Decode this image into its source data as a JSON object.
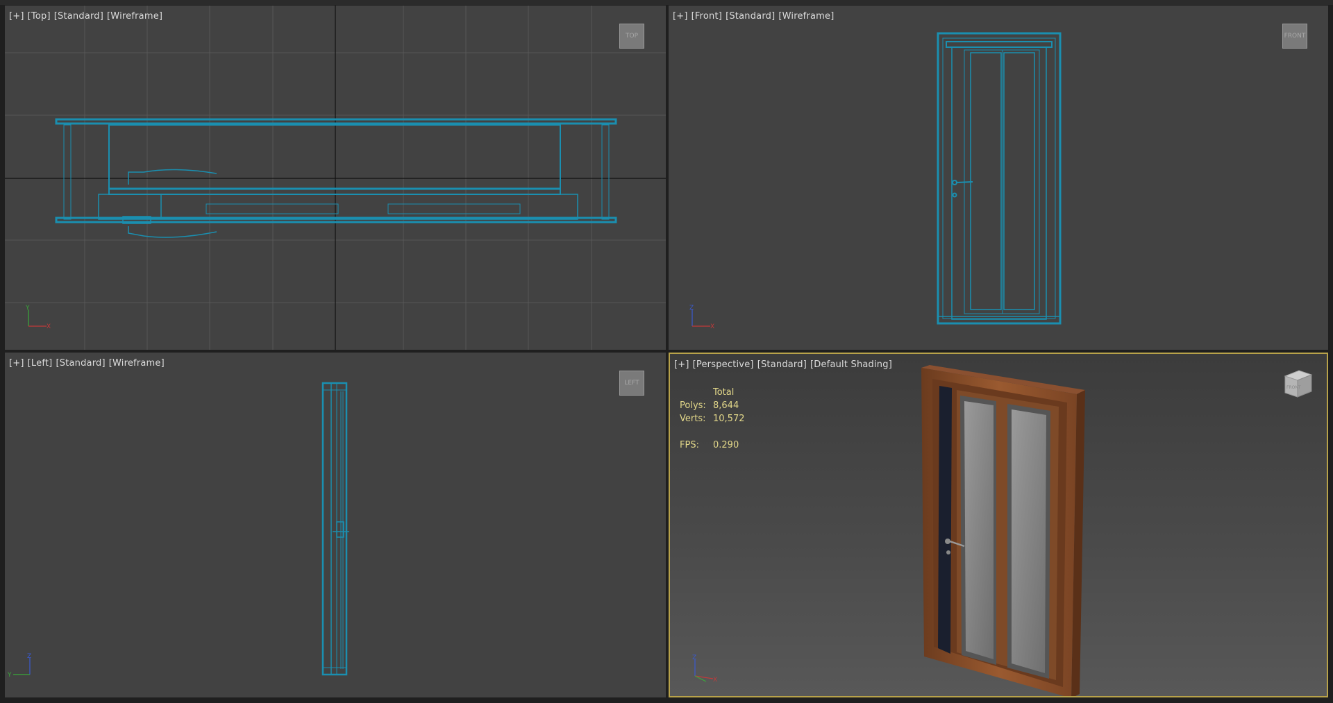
{
  "viewports": {
    "top": {
      "label": [
        "[+]",
        "[Top]",
        "[Standard]",
        "[Wireframe]"
      ],
      "cube_label": "TOP"
    },
    "front": {
      "label": [
        "[+]",
        "[Front]",
        "[Standard]",
        "[Wireframe]"
      ],
      "cube_label": "FRONT"
    },
    "left": {
      "label": [
        "[+]",
        "[Left]",
        "[Standard]",
        "[Wireframe]"
      ],
      "cube_label": "LEFT"
    },
    "perspective": {
      "label": [
        "[+]",
        "[Perspective]",
        "[Standard]",
        "[Default Shading]"
      ],
      "cube_label": "FRONT",
      "stats": {
        "header": "Total",
        "polys_label": "Polys:",
        "polys_value": "8,644",
        "verts_label": "Verts:",
        "verts_value": "10,572",
        "fps_label": "FPS:",
        "fps_value": "0.290"
      }
    }
  },
  "axes": {
    "top": [
      "Y",
      "X"
    ],
    "front": [
      "Z",
      "X"
    ],
    "left": [
      "Z",
      "Y"
    ],
    "perspective": [
      "Z",
      "X"
    ]
  },
  "colors": {
    "wireframe": "#1a8fb0",
    "active_border": "#b8a24a",
    "stats_text": "#e3d88a",
    "viewport_bg": "#424242"
  }
}
